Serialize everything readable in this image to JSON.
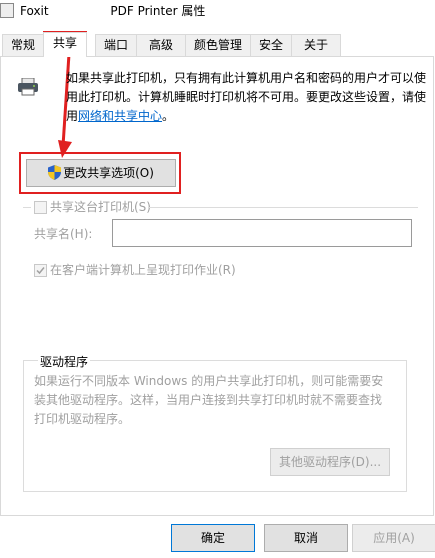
{
  "window": {
    "title": "Foxit PDF Printer 属性",
    "title_prefix": "Foxit ",
    "title_suffix": "PDF Printer 属性"
  },
  "tabs": [
    {
      "label": "常规"
    },
    {
      "label": "共享"
    },
    {
      "label": "端口"
    },
    {
      "label": "高级"
    },
    {
      "label": "颜色管理"
    },
    {
      "label": "安全"
    },
    {
      "label": "关于"
    }
  ],
  "active_tab": "共享",
  "sharing": {
    "info_line1": "如果共享此打印机，只有拥有此计算机用户名和密码的用户才可以使",
    "info_line2": "用此打印机。计算机睡眠时打印机将不可用。要更改这些设置，请使",
    "info_link_prefix": "用",
    "info_link": "网络和共享中心",
    "info_link_suffix": "。",
    "change_options_button": "更改共享选项(O)",
    "share_checkbox_label": "共享这台打印机(S)",
    "share_checkbox_checked": false,
    "share_name_label": "共享名(H):",
    "share_name_value": "",
    "render_checkbox_label": "在客户端计算机上呈现打印作业(R)",
    "render_checkbox_checked": true
  },
  "drivers": {
    "group_title": "驱动程序",
    "text_line1": "如果运行不同版本 Windows 的用户共享此打印机，则可能需要安",
    "text_line2": "装其他驱动程序。这样，当用户连接到共享打印机时就不需要查找",
    "text_line3": "打印机驱动程序。",
    "additional_drivers_button": "其他驱动程序(D)..."
  },
  "footer": {
    "ok": "确定",
    "cancel": "取消",
    "apply": "应用(A)"
  },
  "colors": {
    "highlight": "#e02020",
    "link": "#0066cc",
    "disabled": "#a0a0a0"
  }
}
